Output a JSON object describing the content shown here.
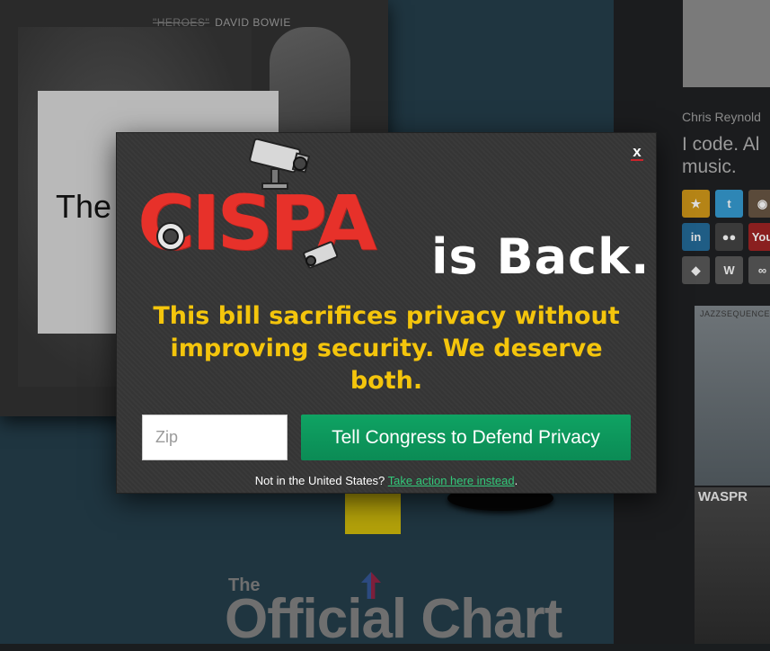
{
  "background": {
    "album_title_struck": "\"HEROES\"",
    "album_title_artist": "DAVID BOWIE",
    "album_card_text": "The",
    "chart_logo_the": "The",
    "chart_logo_main": "Official Chart",
    "profile_name": "Chris Reynold",
    "profile_bio_line1": "I code. Al",
    "profile_bio_line2": "music.",
    "thumb2_label": "JAZZSEQUENCE",
    "thumb3_label": "WASPR",
    "social_icons": [
      {
        "name": "star-icon",
        "glyph": "★",
        "color": "#b58416"
      },
      {
        "name": "twitter-icon",
        "glyph": "t",
        "color": "#2e86b5"
      },
      {
        "name": "instagram-icon",
        "glyph": "◉",
        "color": "#5a4a3a"
      },
      {
        "name": "linkedin-icon",
        "glyph": "in",
        "color": "#1f5d85"
      },
      {
        "name": "flickr-icon",
        "glyph": "●●",
        "color": "#3a3a3a"
      },
      {
        "name": "youtube-icon",
        "glyph": "You",
        "color": "#8a1f1f"
      },
      {
        "name": "github-icon",
        "glyph": "◆",
        "color": "#4d4d4d"
      },
      {
        "name": "wordpress-icon",
        "glyph": "W",
        "color": "#4d4d4d"
      },
      {
        "name": "lastfm-icon",
        "glyph": "∞",
        "color": "#4d4d4d"
      }
    ]
  },
  "modal": {
    "close_label": "x",
    "logo_word": "CISPA",
    "headline_suffix": "is Back.",
    "tagline": "This bill sacrifices privacy without improving security. We deserve both.",
    "zip_placeholder": "Zip",
    "zip_value": "",
    "submit_label": "Tell Congress to Defend Privacy",
    "footnote_prefix": "Not in the United States?",
    "footnote_link": "Take action here instead",
    "footnote_suffix": ".",
    "colors": {
      "logo_red": "#e7312a",
      "tagline_yellow": "#f4c50c",
      "button_green": "#0fa363",
      "link_green": "#32c97a"
    }
  }
}
